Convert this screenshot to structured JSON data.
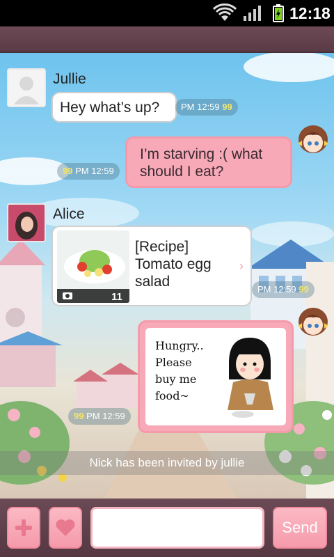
{
  "status_bar": {
    "time": "12:18"
  },
  "messages": [
    {
      "sender": "Jullie",
      "text": "Hey what’s up?",
      "time": "PM 12:59",
      "read_count": "99"
    },
    {
      "text": "I’m starving :( what should I eat?",
      "time": "PM 12:59",
      "read_count": "99"
    },
    {
      "sender": "Alice",
      "card_text": "[Recipe] Tomato egg salad",
      "photo_count": "11",
      "time": "PM 12:59",
      "read_count": "99"
    },
    {
      "sticker_text": "Hungry.. Please buy me food~",
      "time": "PM 12:59",
      "read_count": "99"
    }
  ],
  "system_note": "Nick has been invited by jullie",
  "composer": {
    "input_value": "",
    "send_label": "Send"
  },
  "colors": {
    "accent_pink": "#f7a9b7",
    "bar_brown": "#5a3a45",
    "read_count_yellow": "#f2e66a"
  }
}
